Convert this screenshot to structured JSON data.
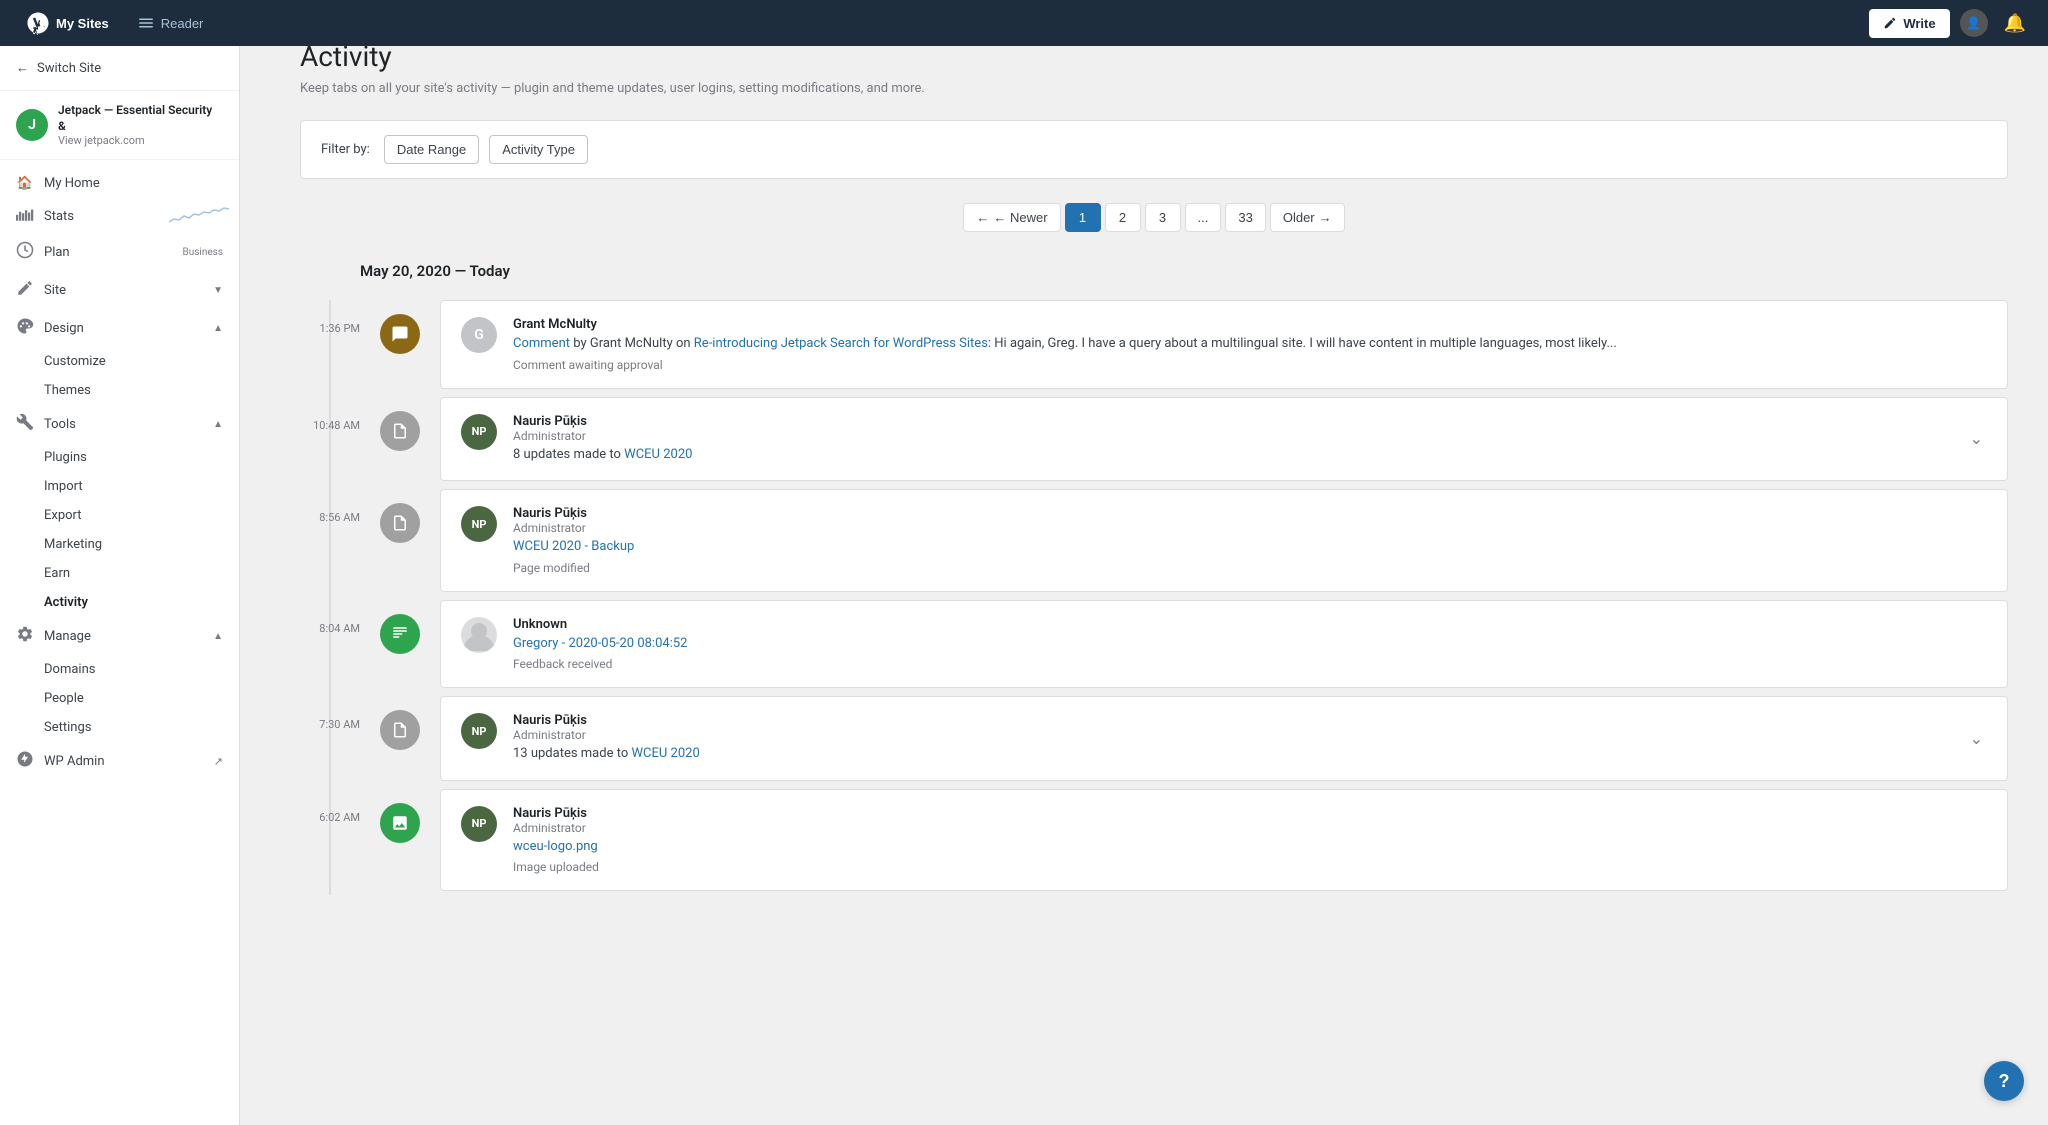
{
  "topbar": {
    "mysites_label": "My Sites",
    "reader_label": "Reader",
    "write_label": "Write"
  },
  "sidebar": {
    "switch_site_label": "Switch Site",
    "site_name": "Jetpack — Essential Security &",
    "site_url": "View jetpack.com",
    "site_initial": "J",
    "nav": [
      {
        "id": "my-home",
        "label": "My Home",
        "icon": "🏠",
        "has_chevron": false
      },
      {
        "id": "stats",
        "label": "Stats",
        "icon": "📊",
        "has_chart": true
      },
      {
        "id": "plan",
        "label": "Plan",
        "icon": "🔄",
        "badge": "Business"
      },
      {
        "id": "site",
        "label": "Site",
        "icon": "✏️",
        "has_chevron": true,
        "expanded": false
      },
      {
        "id": "design",
        "label": "Design",
        "icon": "🎨",
        "has_chevron": true,
        "expanded": true,
        "subitems": [
          {
            "id": "customize",
            "label": "Customize"
          },
          {
            "id": "themes",
            "label": "Themes"
          }
        ]
      },
      {
        "id": "tools",
        "label": "Tools",
        "icon": "🔧",
        "has_chevron": true,
        "expanded": true,
        "subitems": [
          {
            "id": "plugins",
            "label": "Plugins"
          },
          {
            "id": "import",
            "label": "Import"
          },
          {
            "id": "export",
            "label": "Export"
          },
          {
            "id": "marketing",
            "label": "Marketing"
          },
          {
            "id": "earn",
            "label": "Earn"
          },
          {
            "id": "activity",
            "label": "Activity",
            "active": true
          }
        ]
      },
      {
        "id": "manage",
        "label": "Manage",
        "icon": "⚙️",
        "has_chevron": true,
        "expanded": true,
        "subitems": [
          {
            "id": "domains",
            "label": "Domains"
          },
          {
            "id": "people",
            "label": "People"
          },
          {
            "id": "settings",
            "label": "Settings"
          }
        ]
      },
      {
        "id": "wp-admin",
        "label": "WP Admin",
        "icon": "W",
        "external": true
      }
    ]
  },
  "main": {
    "page_title": "Activity",
    "page_description": "Keep tabs on all your site's activity — plugin and theme updates, user logins, setting modifications, and more.",
    "filter": {
      "label": "Filter by:",
      "date_range_label": "Date Range",
      "activity_type_label": "Activity Type"
    },
    "pagination": {
      "newer_label": "← Newer",
      "older_label": "Older →",
      "pages": [
        "1",
        "2",
        "3",
        "...",
        "33"
      ],
      "active_page": "1"
    },
    "date_header": "May 20, 2020 — Today",
    "activities": [
      {
        "id": "act-1",
        "time": "1:36 PM",
        "icon_type": "comment",
        "icon_symbol": "💬",
        "user_name": "Grant McNulty",
        "user_role": "",
        "avatar_type": "letter",
        "avatar_letter": "G",
        "description_prefix": "Comment",
        "description_link_text": "Re-introducing Jetpack Search for WordPress Sites",
        "description_text": ": Hi again, Greg. I have a query about a multilingual site. I will have content in multiple languages, most likely...",
        "description_by": "by Grant McNulty on",
        "subtext": "Comment awaiting approval",
        "expandable": false
      },
      {
        "id": "act-2",
        "time": "10:48 AM",
        "icon_type": "edit",
        "icon_symbol": "📋",
        "user_name": "Nauris Pūķis",
        "user_role": "Administrator",
        "avatar_type": "nauris",
        "description_text": "8 updates made to",
        "description_link": "WCEU 2020",
        "subtext": "",
        "expandable": true
      },
      {
        "id": "act-3",
        "time": "8:56 AM",
        "icon_type": "edit",
        "icon_symbol": "📋",
        "user_name": "Nauris Pūķis",
        "user_role": "Administrator",
        "avatar_type": "nauris",
        "description_link": "WCEU 2020 - Backup",
        "description_text": "",
        "subtext": "Page modified",
        "expandable": false
      },
      {
        "id": "act-4",
        "time": "8:04 AM",
        "icon_type": "feedback",
        "icon_symbol": "⊞",
        "user_name": "Unknown",
        "user_role": "",
        "avatar_type": "person",
        "description_link": "Gregory - 2020-05-20 08:04:52",
        "description_text": "",
        "subtext": "Feedback received",
        "expandable": false
      },
      {
        "id": "act-5",
        "time": "7:30 AM",
        "icon_type": "edit",
        "icon_symbol": "📋",
        "user_name": "Nauris Pūķis",
        "user_role": "Administrator",
        "avatar_type": "nauris",
        "description_text": "13 updates made to",
        "description_link": "WCEU 2020",
        "subtext": "",
        "expandable": true
      },
      {
        "id": "act-6",
        "time": "6:02 AM",
        "icon_type": "image",
        "icon_symbol": "🖼️",
        "user_name": "Nauris Pūķis",
        "user_role": "Administrator",
        "avatar_type": "nauris",
        "description_link": "wceu-logo.png",
        "description_text": "",
        "subtext": "Image uploaded",
        "expandable": false
      }
    ]
  },
  "help_label": "?"
}
